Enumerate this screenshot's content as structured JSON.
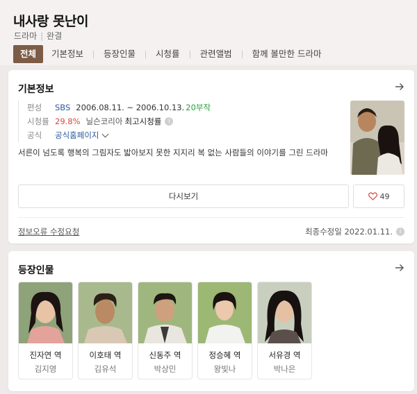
{
  "header": {
    "title": "내사랑 못난이",
    "genre": "드라마",
    "status": "완결",
    "tabs": [
      "전체",
      "기본정보",
      "등장인물",
      "시청률",
      "관련앨범",
      "함께 볼만한 드라마"
    ],
    "active_tab": "전체"
  },
  "basic_info": {
    "title": "기본정보",
    "broadcast_label": "편성",
    "channel": "SBS",
    "period": "2006.08.11. ~ 2006.10.13.",
    "episodes": "20부작",
    "rating_label": "시청률",
    "rating": "29.8%",
    "rating_source": "닐슨코리아",
    "rating_type": "최고시청률",
    "official_label": "공식",
    "official_link": "공식홈페이지",
    "description": "서른이 넘도록 행복의 그림자도 밟아보지 못한 지지리 복 없는 사람들의 이야기를 그린 드라마",
    "replay_button": "다시보기",
    "likes": "49",
    "error_report": "정보오류 수정요청",
    "modified": "최종수정일 2022.01.11."
  },
  "cast_section": {
    "title": "등장인물",
    "members": [
      {
        "role": "진자연 역",
        "actor": "김지영"
      },
      {
        "role": "이호태 역",
        "actor": "김유석"
      },
      {
        "role": "신동주 역",
        "actor": "박상민"
      },
      {
        "role": "정승혜 역",
        "actor": "왕빛나"
      },
      {
        "role": "서유경 역",
        "actor": "박나은"
      }
    ]
  },
  "colors": {
    "accent": "#7c5c47",
    "link": "#2d5a9c",
    "episodes": "#2a9d3b",
    "rating": "#d6493a"
  },
  "icons": [
    "arrow-right-icon",
    "chevron-down-icon",
    "info-icon",
    "heart-icon"
  ]
}
